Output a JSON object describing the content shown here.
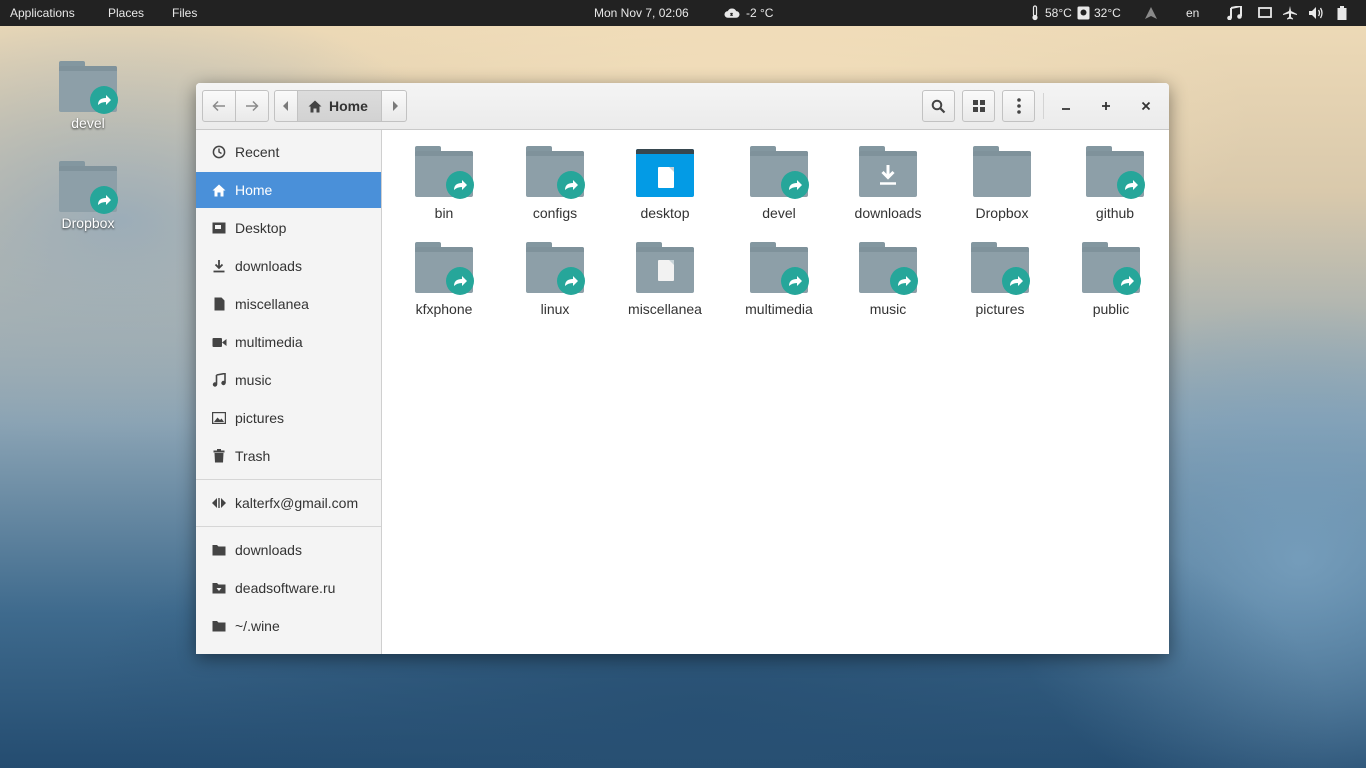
{
  "topbar": {
    "applications": "Applications",
    "places": "Places",
    "files": "Files",
    "clock": "Mon Nov  7, 02:06",
    "weather": "-2 °C",
    "cpu_temp": "58°C",
    "disk_temp": "32°C",
    "language": "en"
  },
  "desktop": {
    "icons": [
      {
        "label": "devel"
      },
      {
        "label": "Dropbox"
      }
    ]
  },
  "window": {
    "breadcrumb": "Home"
  },
  "sidebar": {
    "items": [
      {
        "label": "Recent",
        "icon": "clock-icon"
      },
      {
        "label": "Home",
        "icon": "home-icon",
        "active": true
      },
      {
        "label": "Desktop",
        "icon": "desktop-icon"
      },
      {
        "label": "downloads",
        "icon": "download-icon"
      },
      {
        "label": "miscellanea",
        "icon": "document-icon"
      },
      {
        "label": "multimedia",
        "icon": "video-icon"
      },
      {
        "label": "music",
        "icon": "music-icon"
      },
      {
        "label": "pictures",
        "icon": "image-icon"
      },
      {
        "label": "Trash",
        "icon": "trash-icon"
      }
    ],
    "network": [
      {
        "label": "kalterfx@gmail.com",
        "icon": "network-share-icon"
      }
    ],
    "bookmarks": [
      {
        "label": "downloads",
        "icon": "folder-icon"
      },
      {
        "label": "deadsoftware.ru",
        "icon": "folder-remote-icon"
      },
      {
        "label": "~/.wine",
        "icon": "folder-icon"
      }
    ]
  },
  "files": [
    {
      "label": "bin",
      "kind": "link"
    },
    {
      "label": "configs",
      "kind": "link"
    },
    {
      "label": "desktop",
      "kind": "desktop"
    },
    {
      "label": "devel",
      "kind": "link"
    },
    {
      "label": "downloads",
      "kind": "download"
    },
    {
      "label": "Dropbox",
      "kind": "folder"
    },
    {
      "label": "github",
      "kind": "link"
    },
    {
      "label": "kfxphone",
      "kind": "link"
    },
    {
      "label": "linux",
      "kind": "link"
    },
    {
      "label": "miscellanea",
      "kind": "document"
    },
    {
      "label": "multimedia",
      "kind": "link"
    },
    {
      "label": "music",
      "kind": "link"
    },
    {
      "label": "pictures",
      "kind": "link"
    },
    {
      "label": "public",
      "kind": "link"
    }
  ],
  "colors": {
    "accent": "#4a90d9",
    "folder": "#8d9fa8",
    "link_badge": "#26a69a",
    "desktop_folder": "#039be5"
  }
}
